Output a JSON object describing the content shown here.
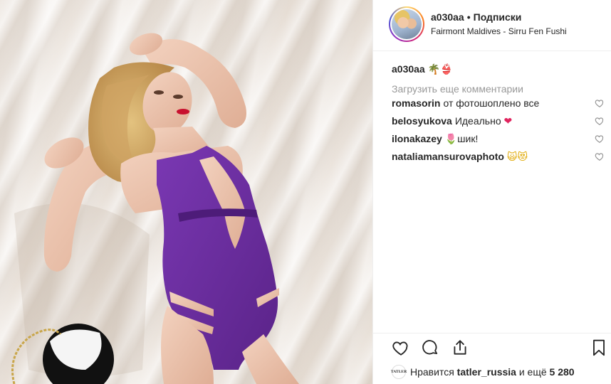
{
  "post": {
    "username": "a030aa",
    "separator": "•",
    "follow_label": "Подписки",
    "location": "Fairmont Maldives - Sirru Fen Fushi",
    "caption_user": "a030aa",
    "caption_emoji_1": "🌴",
    "caption_emoji_2": "👙"
  },
  "load_more": "Загрузить еще комментарии",
  "comments": [
    {
      "user": "romasorin",
      "text": "от фотошоплено все"
    },
    {
      "user": "belosyukova",
      "text": "Идеально",
      "emoji": "❤"
    },
    {
      "user": "ilonakazey",
      "emoji": "🌷",
      "text": "шик!"
    },
    {
      "user": "nataliamansurovaphoto",
      "emoji": "🙀😻"
    }
  ],
  "likes": {
    "prefix": "Нравится",
    "user": "tatler_russia",
    "middle": "и ещё",
    "count": "5 280",
    "avatar_text": "TATLER"
  },
  "icons": {
    "like": "heart-outline-icon",
    "comment": "comment-bubble-icon",
    "share": "share-icon",
    "save": "bookmark-icon"
  },
  "colors": {
    "swimsuit": "#6b2d9e",
    "text": "#262626",
    "muted": "#999999",
    "border": "#efefef"
  }
}
